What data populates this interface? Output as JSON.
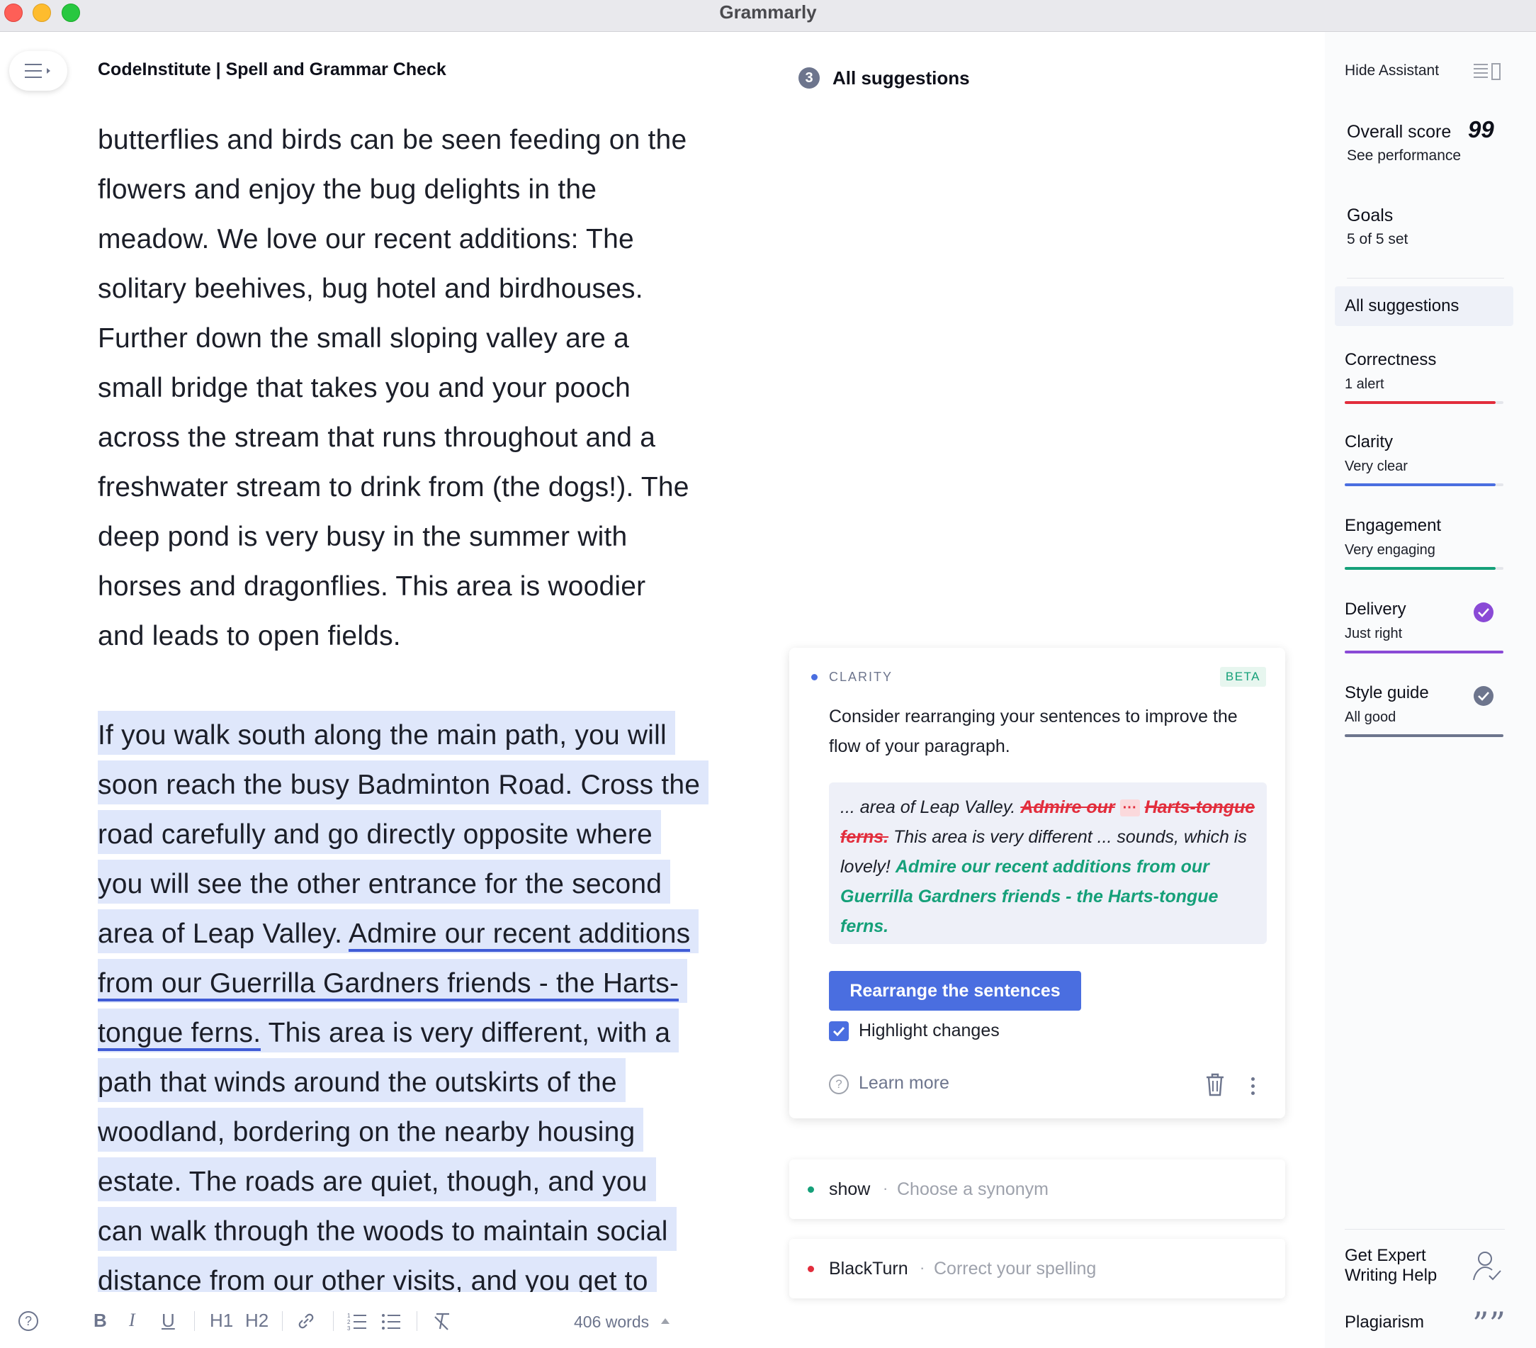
{
  "window": {
    "title": "Grammarly"
  },
  "editor": {
    "doc_title": "CodeInstitute | Spell and Grammar Check",
    "cut_line": ", , , ,",
    "paragraph1": [
      "butterflies and birds can be seen feeding on the",
      "flowers and enjoy the bug delights in the",
      "meadow. We love our recent additions: The",
      "solitary beehives, bug hotel and birdhouses.",
      "Further down the small sloping valley are a",
      "small bridge that takes you and your pooch",
      "across the stream that runs throughout and a",
      "freshwater stream to drink from (the dogs!). The",
      "deep pond is very busy in the summer with",
      "horses and dragonflies. This area is woodier",
      "and leads to open fields."
    ],
    "paragraph2": {
      "l1": "If you walk south along the main path, you will",
      "l2": "soon reach the busy Badminton Road. Cross the",
      "l3": "road carefully and go directly opposite where",
      "l4": "you will see the other entrance for the second",
      "l5_pre": "area of Leap Valley. ",
      "l5_ul": "Admire our recent additions",
      "l6_ul": "from our Guerrilla Gardners friends - the Harts-",
      "l7_ul": "tongue ferns.",
      "l7_post": " This area is very different, with a",
      "l8": "path that winds around the outskirts of the",
      "l9": "woodland, bordering on the nearby housing",
      "l10": "estate. The roads are quiet, though, and you",
      "l11": "can walk through the woods to maintain social",
      "l12": "distance from our other visits, and you get to"
    },
    "toolbar": {
      "bold": "B",
      "italic": "I",
      "underline": "U",
      "h1": "H1",
      "h2": "H2",
      "word_count": "406 words"
    }
  },
  "suggestions": {
    "count": "3",
    "title": "All suggestions",
    "card": {
      "category": "CLARITY",
      "badge": "BETA",
      "message": "Consider rearranging your sentences to improve the flow of your paragraph.",
      "preview": {
        "lead": "... area of Leap Valley. ",
        "del1": "Admire our",
        "dots": "···",
        "del2": "Harts-tongue ferns.",
        "mid": " This area is very different ... sounds, which is lovely! ",
        "ins": "Admire our recent additions from our Guerrilla Gardners friends - the Harts-tongue ferns."
      },
      "action": "Rearrange the sentences",
      "checkbox_label": "Highlight changes",
      "learn_more": "Learn more"
    },
    "mini": [
      {
        "word": "show",
        "hint": "Choose a synonym",
        "color": "#15a079"
      },
      {
        "word": "BlackTurn",
        "hint": "Correct your spelling",
        "color": "#e22d3c"
      }
    ]
  },
  "sidebar": {
    "hide_assistant": "Hide Assistant",
    "overall_label": "Overall score",
    "overall_value": "99",
    "see_performance": "See performance",
    "goals": "Goals",
    "goals_sub": "5 of 5 set",
    "all_suggestions": "All suggestions",
    "categories": [
      {
        "name": "Correctness",
        "sub": "1 alert",
        "color": "#e22d3c"
      },
      {
        "name": "Clarity",
        "sub": "Very clear",
        "color": "#4a6ee0"
      },
      {
        "name": "Engagement",
        "sub": "Very engaging",
        "color": "#15a079"
      },
      {
        "name": "Delivery",
        "sub": "Just right",
        "color": "#8a4ad6"
      },
      {
        "name": "Style guide",
        "sub": "All good",
        "color": "#6d758d"
      }
    ],
    "expert_help": "Get Expert Writing Help",
    "plagiarism": "Plagiarism"
  }
}
